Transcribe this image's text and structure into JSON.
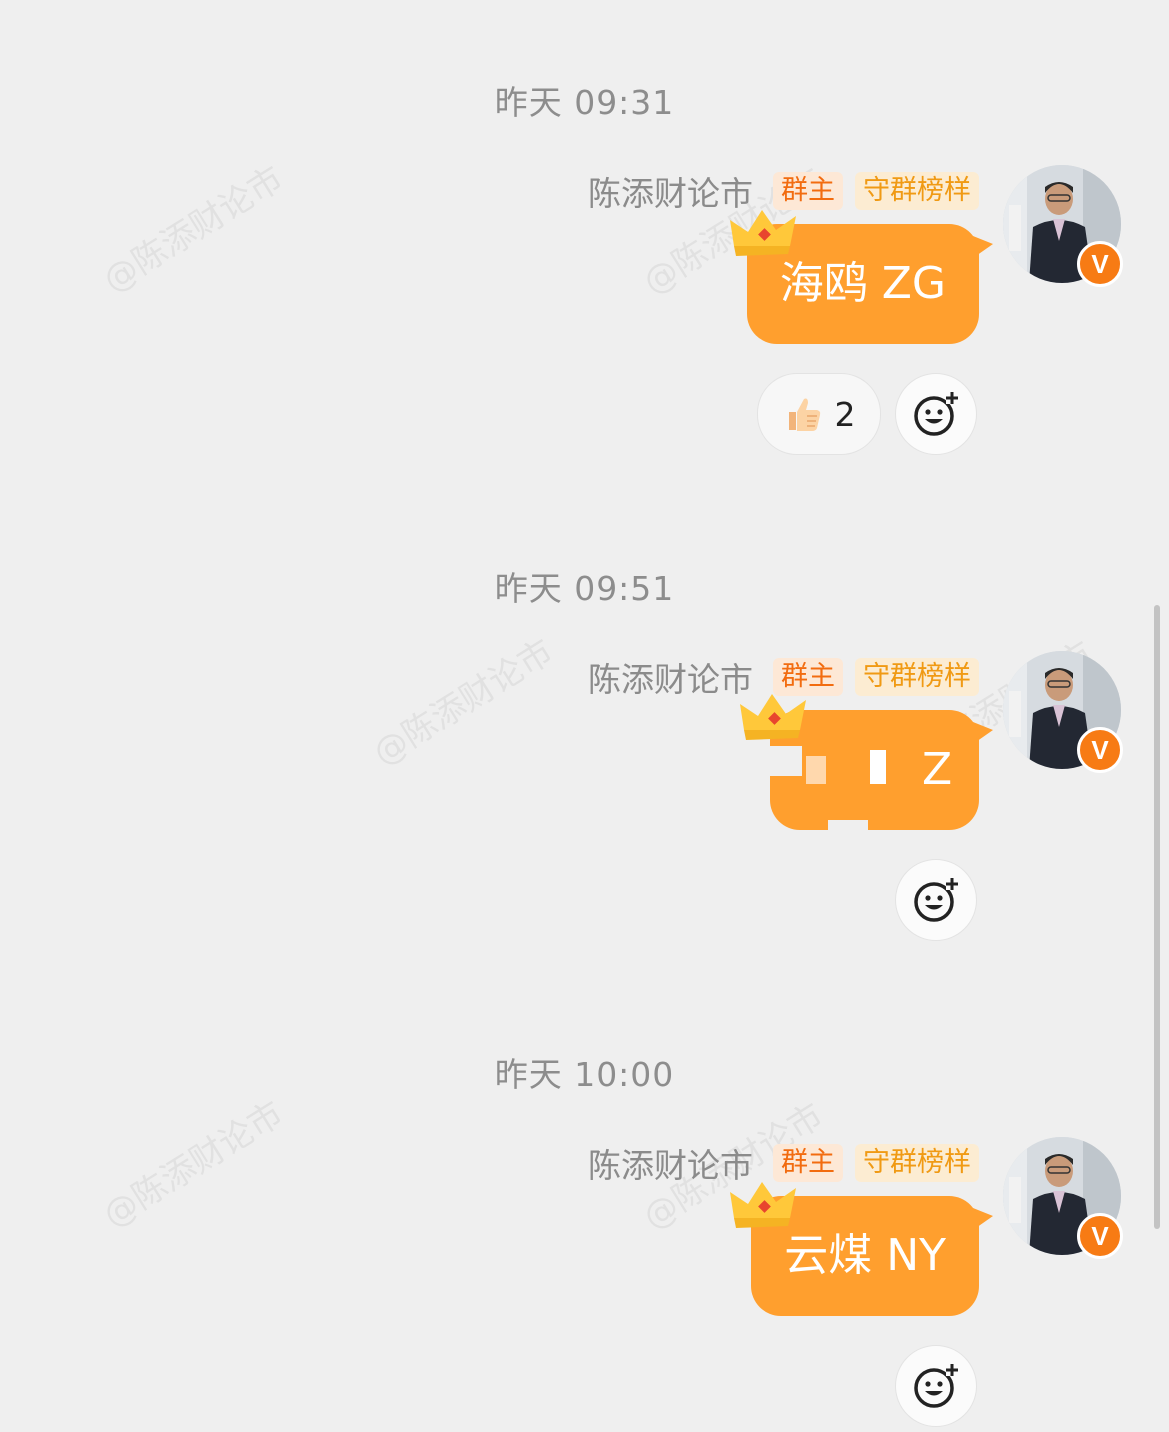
{
  "chat": {
    "watermark_text": "@陈添财论市",
    "messages": [
      {
        "timestamp": "昨天 09:31",
        "sender": "陈添财论市",
        "badges": [
          "群主",
          "守群榜样"
        ],
        "text": "海鸥 ZG",
        "reactions": [
          {
            "emoji": "thumbs-up",
            "count": "2"
          }
        ]
      },
      {
        "timestamp": "昨天 09:51",
        "sender": "陈添财论市",
        "badges": [
          "群主",
          "守群榜样"
        ],
        "text": "Z",
        "reactions": []
      },
      {
        "timestamp": "昨天 10:00",
        "sender": "陈添财论市",
        "badges": [
          "群主",
          "守群榜样"
        ],
        "text": "云煤 NY",
        "reactions": []
      }
    ],
    "verify_letter": "V"
  },
  "colors": {
    "bubble": "#ff9f2e",
    "background": "#efefef",
    "badge_owner": "#f26c10",
    "badge_model": "#f09a14",
    "verify": "#f77b14"
  }
}
